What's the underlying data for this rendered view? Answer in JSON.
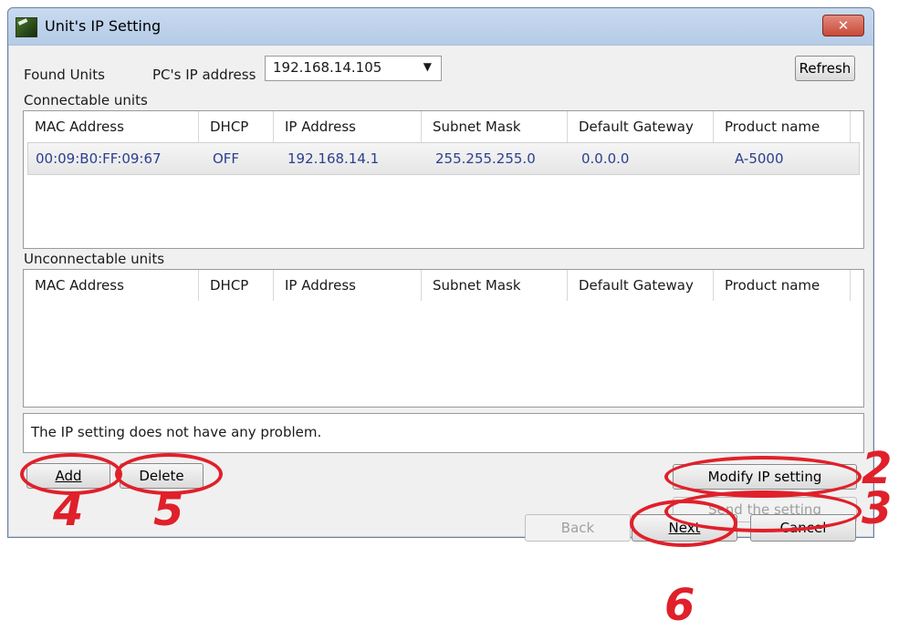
{
  "window": {
    "title": "Unit's IP Setting",
    "close_label": "✕"
  },
  "top": {
    "found_units_label": "Found Units",
    "pc_ip_label": "PC's IP address",
    "pc_ip_value": "192.168.14.105",
    "refresh_label": "Refresh"
  },
  "connectable": {
    "label": "Connectable units",
    "columns": [
      "MAC Address",
      "DHCP",
      "IP Address",
      "Subnet Mask",
      "Default Gateway",
      "Product name"
    ],
    "rows": [
      [
        "00:09:B0:FF:09:67",
        "OFF",
        "192.168.14.1",
        "255.255.255.0",
        "0.0.0.0",
        "A-5000"
      ]
    ]
  },
  "unconnectable": {
    "label": "Unconnectable units",
    "columns": [
      "MAC Address",
      "DHCP",
      "IP Address",
      "Subnet Mask",
      "Default Gateway",
      "Product name"
    ]
  },
  "status_message": "The IP setting does not have any problem.",
  "buttons": {
    "add": "Add",
    "delete": "Delete",
    "modify": "Modify IP setting",
    "send": "Send the setting",
    "back": "Back",
    "next": "Next",
    "cancel": "Cancel"
  },
  "callouts": {
    "n2": "2",
    "n3": "3",
    "n4": "4",
    "n5": "5",
    "n6": "6",
    "color": "#e0202a"
  }
}
